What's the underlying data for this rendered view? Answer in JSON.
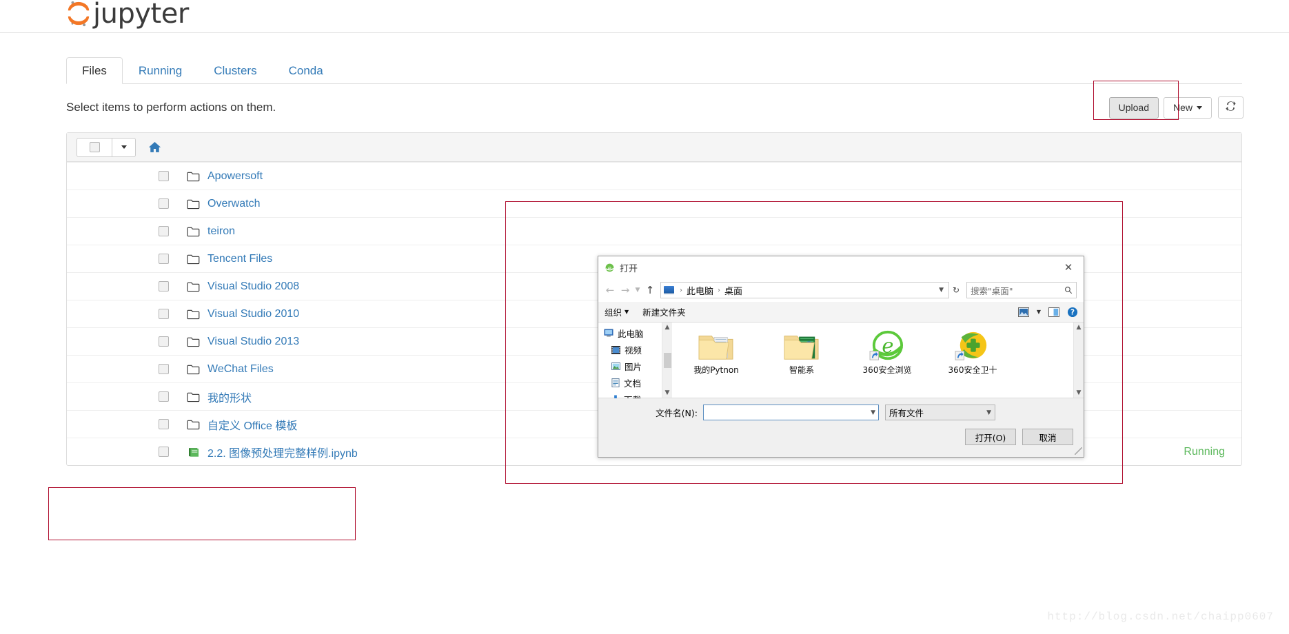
{
  "app": {
    "logo_text": "jupyter",
    "logo_icon": "jupyter-logo-icon"
  },
  "tabs": [
    {
      "label": "Files",
      "active": true
    },
    {
      "label": "Running",
      "active": false
    },
    {
      "label": "Clusters",
      "active": false
    },
    {
      "label": "Conda",
      "active": false
    }
  ],
  "toolbar": {
    "subtitle": "Select items to perform actions on them.",
    "upload_label": "Upload",
    "new_label": "New",
    "refresh_icon": "refresh-icon",
    "home_icon": "home-icon"
  },
  "files": [
    {
      "name": "Apowersoft",
      "type": "folder",
      "status": ""
    },
    {
      "name": "Overwatch",
      "type": "folder",
      "status": ""
    },
    {
      "name": "teiron",
      "type": "folder",
      "status": ""
    },
    {
      "name": "Tencent Files",
      "type": "folder",
      "status": ""
    },
    {
      "name": "Visual Studio 2008",
      "type": "folder",
      "status": ""
    },
    {
      "name": "Visual Studio 2010",
      "type": "folder",
      "status": ""
    },
    {
      "name": "Visual Studio 2013",
      "type": "folder",
      "status": ""
    },
    {
      "name": "WeChat Files",
      "type": "folder",
      "status": ""
    },
    {
      "name": "我的形状",
      "type": "folder",
      "status": ""
    },
    {
      "name": "自定义 Office 模板",
      "type": "folder",
      "status": ""
    },
    {
      "name": "2.2. 图像预处理完整样例.ipynb",
      "type": "notebook",
      "status": "Running"
    }
  ],
  "dialog": {
    "title": "打开",
    "title_icon": "ie-browser-icon",
    "close_icon": "close-icon",
    "nav": {
      "back_icon": "arrow-left-icon",
      "forward_icon": "arrow-right-icon",
      "history_icon": "chevron-down-icon",
      "up_icon": "arrow-up-icon"
    },
    "breadcrumb": [
      "此电脑",
      "桌面"
    ],
    "address_caret": "chevron-down-icon",
    "refresh_icon": "refresh-circular-icon",
    "search_placeholder": "搜索\"桌面\"",
    "search_icon": "search-icon",
    "toolbar": {
      "organize_label": "组织",
      "new_folder_label": "新建文件夹",
      "view_icon": "view-layout-icon",
      "view_caret": "chevron-down-icon",
      "preview_icon": "preview-pane-icon",
      "help_icon": "help-circle-icon"
    },
    "sidebar": [
      {
        "label": "此电脑",
        "icon": "computer-icon",
        "indent": false
      },
      {
        "label": "视频",
        "icon": "video-icon",
        "indent": true
      },
      {
        "label": "图片",
        "icon": "picture-icon",
        "indent": true
      },
      {
        "label": "文档",
        "icon": "document-icon",
        "indent": true
      },
      {
        "label": "下载",
        "icon": "download-icon",
        "indent": true
      }
    ],
    "items": [
      {
        "label": "我的Pytnon",
        "icon": "folder-icon"
      },
      {
        "label": "智能系",
        "icon": "folder-green-icon"
      },
      {
        "label": "360安全浏览",
        "icon": "ie-shortcut-icon"
      },
      {
        "label": "360安全卫十",
        "icon": "360-safe-icon"
      }
    ],
    "filename_label": "文件名(N):",
    "filename_value": "",
    "filetype_value": "所有文件",
    "open_button": "打开(O)",
    "cancel_button": "取消"
  },
  "watermark": "http://blog.csdn.net/chaipp0607",
  "colors": {
    "link": "#337ab7",
    "running": "#5cb85c",
    "annotation": "#b01030",
    "jupyter_orange": "#f37726"
  }
}
